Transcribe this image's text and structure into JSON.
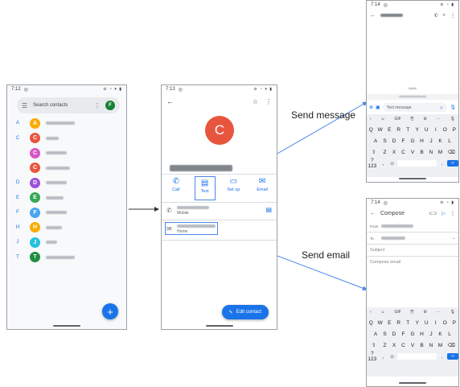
{
  "annotations": {
    "send_message": "Send message",
    "send_email": "Send email"
  },
  "contacts_screen": {
    "time": "7:12",
    "search_placeholder": "Search contacts",
    "account_initial": "F",
    "groups": [
      {
        "letter": "A",
        "initial": "A",
        "color": "#f9ab00"
      },
      {
        "letter": "C",
        "initial": "C",
        "color": "#e8553e"
      },
      {
        "letter": "",
        "initial": "C",
        "color": "#d656c5"
      },
      {
        "letter": "",
        "initial": "C",
        "color": "#e8553e"
      },
      {
        "letter": "D",
        "initial": "D",
        "color": "#9c4fdb"
      },
      {
        "letter": "E",
        "initial": "E",
        "color": "#34a853"
      },
      {
        "letter": "F",
        "initial": "F",
        "color": "#4aa3f0"
      },
      {
        "letter": "H",
        "initial": "H",
        "color": "#f9ab00"
      },
      {
        "letter": "J",
        "initial": "J",
        "color": "#24c1e0"
      },
      {
        "letter": "T",
        "initial": "T",
        "color": "#1e8e3e"
      }
    ],
    "fab": "+"
  },
  "contact_detail": {
    "time": "7:13",
    "avatar_initial": "C",
    "actions": [
      {
        "label": "Call",
        "icon": "phone-icon",
        "glyph": "✆"
      },
      {
        "label": "Text",
        "icon": "message-icon",
        "glyph": "▤"
      },
      {
        "label": "Set up",
        "icon": "video-icon",
        "glyph": "▭"
      },
      {
        "label": "Email",
        "icon": "mail-icon",
        "glyph": "✉"
      }
    ],
    "phone_type": "Mobile",
    "email_type": "Home",
    "edit_button": "Edit contact"
  },
  "messages_screen": {
    "time": "7:14",
    "composer_placeholder": "Text message",
    "keyboard": {
      "tools": [
        "‹",
        "☺",
        "GIF",
        "⎘",
        "⚙",
        "···",
        "🎙"
      ],
      "row1": [
        "Q",
        "W",
        "E",
        "R",
        "T",
        "Y",
        "U",
        "I",
        "O",
        "P"
      ],
      "row2": [
        "A",
        "S",
        "D",
        "F",
        "G",
        "H",
        "J",
        "K",
        "L"
      ],
      "row3": [
        "Z",
        "X",
        "C",
        "V",
        "B",
        "N",
        "M"
      ],
      "symbols": "?123",
      "comma": ","
    }
  },
  "compose_screen": {
    "time": "7:14",
    "title": "Compose",
    "from_label": "From",
    "to_label": "To",
    "subject_placeholder": "Subject",
    "body_placeholder": "Compose email",
    "keyboard": {
      "tools": [
        "‹",
        "☺",
        "GIF",
        "⎘",
        "⚙",
        "···",
        "🎙"
      ],
      "row1": [
        "Q",
        "W",
        "E",
        "R",
        "T",
        "Y",
        "U",
        "I",
        "O",
        "P"
      ],
      "row2": [
        "A",
        "S",
        "D",
        "F",
        "G",
        "H",
        "J",
        "K",
        "L"
      ],
      "row3": [
        "Z",
        "X",
        "C",
        "V",
        "B",
        "N",
        "M"
      ],
      "symbols": "?123",
      "comma": ","
    }
  }
}
